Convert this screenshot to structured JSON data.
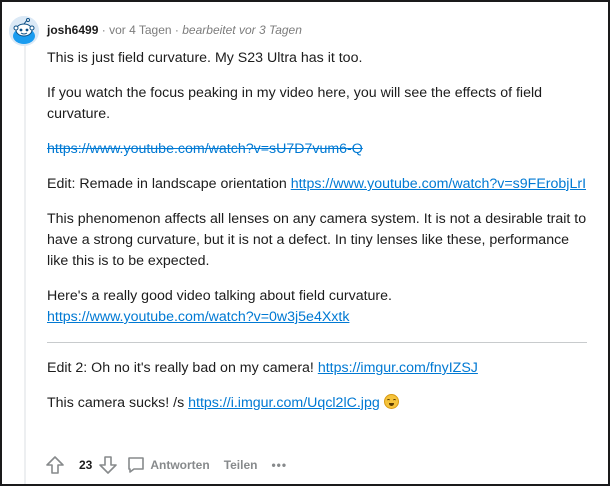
{
  "comment": {
    "author": "josh6499",
    "time": "vor 4 Tagen",
    "edited": "bearbeitet vor 3 Tagen",
    "separator": "·",
    "body": {
      "p1": "This is just field curvature. My S23 Ultra has it too.",
      "p2": "If you watch the focus peaking in my video here, you will see the effects of field curvature.",
      "link1": "https://www.youtube.com/watch?v=sU7D7vum6-Q",
      "p3_text": "Edit: Remade in landscape orientation ",
      "link2": "https://www.youtube.com/watch?v=s9FErobjLrI",
      "p4": "This phenomenon affects all lenses on any camera system. It is not a desirable trait to have a strong curvature, but it is not a defect. In tiny lenses like these, performance like this is to be expected.",
      "p5_text": "Here's a really good video talking about field curvature.",
      "link3": "https://www.youtube.com/watch?v=0w3j5e4Xxtk",
      "p6_text": "Edit 2: Oh no it's really bad on my camera! ",
      "link4": "https://imgur.com/fnyIZSJ",
      "p7_text": "This camera sucks! /s ",
      "link5": "https://i.imgur.com/Uqcl2lC.jpg"
    },
    "actions": {
      "votes": "23",
      "reply": "Antworten",
      "share": "Teilen",
      "more": "•••"
    }
  },
  "colors": {
    "link": "#0079d3",
    "meta": "#7c7c7c",
    "text": "#1c1c1c"
  },
  "icons": [
    "avatar-snoo-icon",
    "upvote-arrow-icon",
    "downvote-arrow-icon",
    "comment-bubble-icon",
    "emoji-grimace-icon"
  ]
}
